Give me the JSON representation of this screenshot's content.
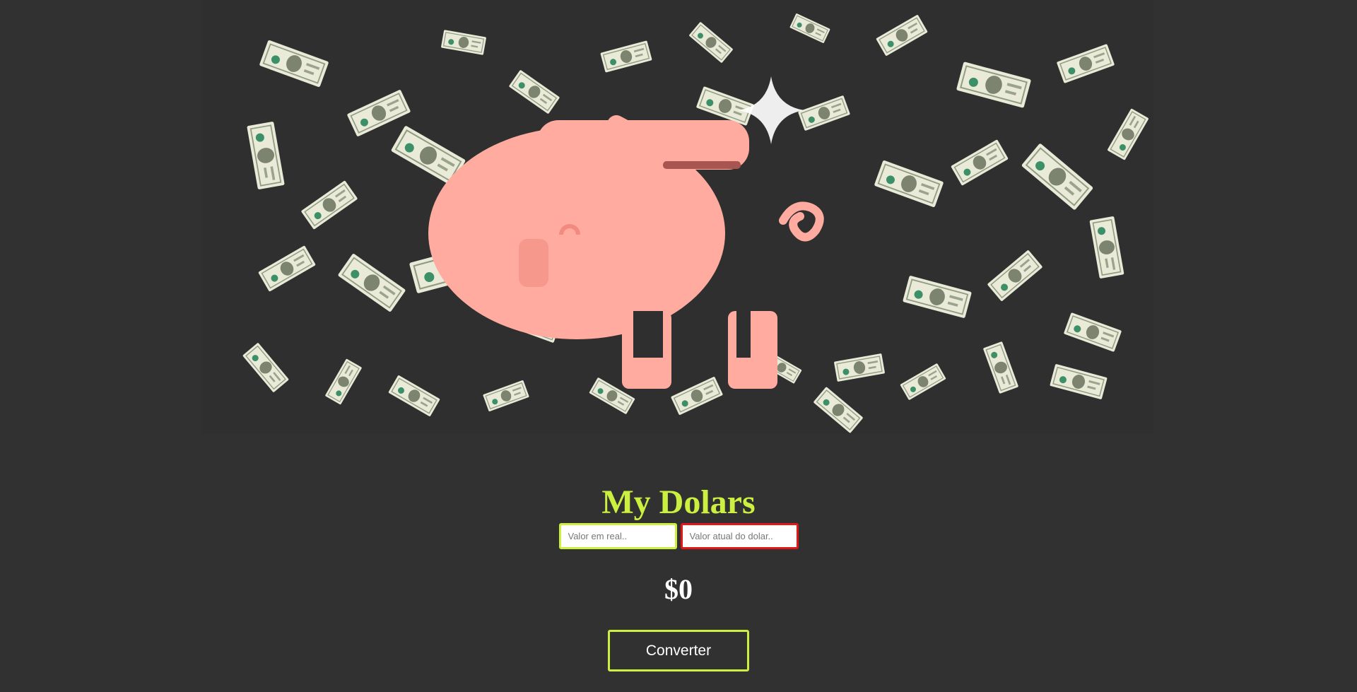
{
  "theme": {
    "accent": "#ccf03f",
    "danger": "#e01818",
    "background": "#313131",
    "piggy": "#ffaba0"
  },
  "hero": {
    "image": "piggy-bank-with-falling-dollar-bills"
  },
  "title": "My Dolars",
  "inputs": {
    "real_placeholder": "Valor em real..",
    "rate_placeholder": "Valor atual do dolar.."
  },
  "result": "$0",
  "convert_label": "Converter"
}
